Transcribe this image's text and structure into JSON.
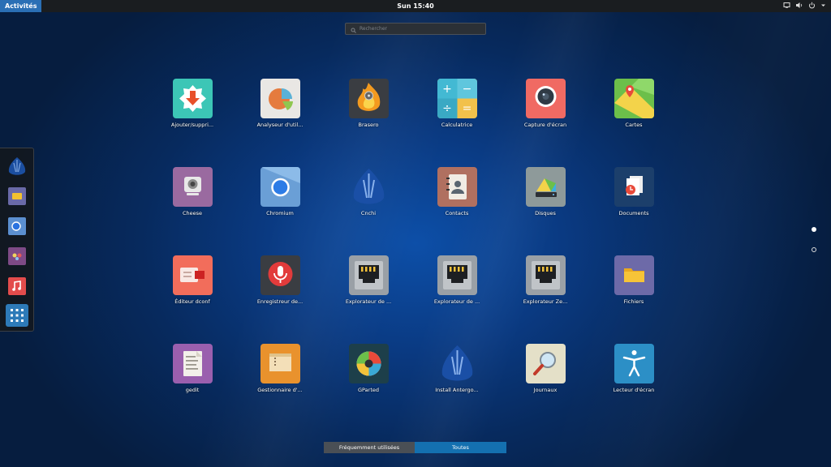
{
  "topbar": {
    "activities_label": "Activités",
    "clock": "Sun 15:40"
  },
  "search": {
    "placeholder": "Rechercher"
  },
  "dock": [
    {
      "name": "cnchi"
    },
    {
      "name": "files"
    },
    {
      "name": "chromium"
    },
    {
      "name": "cheese"
    },
    {
      "name": "music"
    },
    {
      "name": "show-applications"
    }
  ],
  "apps": [
    {
      "label": "Ajouter/suppri...",
      "icon": "add-remove-icon"
    },
    {
      "label": "Analyseur d'util...",
      "icon": "disk-usage-analyzer-icon"
    },
    {
      "label": "Brasero",
      "icon": "brasero-icon"
    },
    {
      "label": "Calculatrice",
      "icon": "calculator-icon"
    },
    {
      "label": "Capture d'écran",
      "icon": "screenshot-icon"
    },
    {
      "label": "Cartes",
      "icon": "maps-icon"
    },
    {
      "label": "Cheese",
      "icon": "cheese-icon"
    },
    {
      "label": "Chromium",
      "icon": "chromium-icon"
    },
    {
      "label": "Cnchi",
      "icon": "cnchi-icon"
    },
    {
      "label": "Contacts",
      "icon": "contacts-icon"
    },
    {
      "label": "Disques",
      "icon": "disks-icon"
    },
    {
      "label": "Documents",
      "icon": "documents-icon"
    },
    {
      "label": "Éditeur dconf",
      "icon": "dconf-editor-icon"
    },
    {
      "label": "Enregistreur de...",
      "icon": "sound-recorder-icon"
    },
    {
      "label": "Explorateur de ...",
      "icon": "network-explorer-icon"
    },
    {
      "label": "Explorateur de ...",
      "icon": "network-explorer-icon"
    },
    {
      "label": "Explorateur Ze...",
      "icon": "network-explorer-icon"
    },
    {
      "label": "Fichiers",
      "icon": "files-icon"
    },
    {
      "label": "gedit",
      "icon": "gedit-icon"
    },
    {
      "label": "Gestionnaire d'...",
      "icon": "archive-manager-icon"
    },
    {
      "label": "GParted",
      "icon": "gparted-icon"
    },
    {
      "label": "Install Antergo...",
      "icon": "install-antergos-icon"
    },
    {
      "label": "Journaux",
      "icon": "logs-icon"
    },
    {
      "label": "Lecteur d'écran",
      "icon": "screen-reader-icon"
    }
  ],
  "view_switch": {
    "frequent": "Fréquemment utilisées",
    "all": "Toutes"
  },
  "colors": {
    "accent": "#2a6fb5",
    "active_tab": "#1470b0",
    "inactive_tab": "#4a4f55"
  }
}
